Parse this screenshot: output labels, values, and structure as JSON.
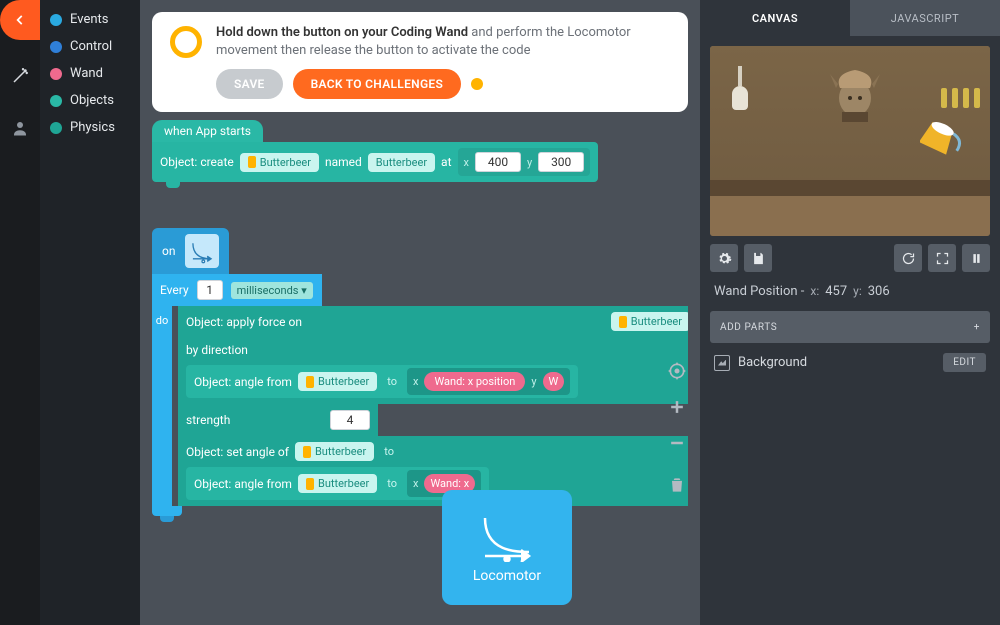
{
  "sidebar": {
    "items": [
      {
        "label": "Events",
        "color": "#2aa9e0"
      },
      {
        "label": "Control",
        "color": "#2f7fd8"
      },
      {
        "label": "Wand",
        "color": "#ef6a8e"
      },
      {
        "label": "Objects",
        "color": "#2ab8a6"
      },
      {
        "label": "Physics",
        "color": "#1fa595"
      }
    ]
  },
  "banner": {
    "bold": "Hold down the button on your Coding Wand",
    "rest": " and perform the Locomotor movement then release the button to activate the code",
    "save": "SAVE",
    "back": "BACK TO CHALLENGES"
  },
  "blocks": {
    "hat": "when App starts",
    "obj_create": "Object: create",
    "butterbeer": "Butterbeer",
    "named": "named",
    "at": "at",
    "x": "x",
    "y": "y",
    "xv": "400",
    "yv": "300",
    "on": "on",
    "every": "Every",
    "every_n": "1",
    "ms": "milliseconds",
    "do": "do",
    "apply": "Object: apply force on",
    "bydir": "by direction",
    "angle_from": "Object: angle from",
    "to": "to",
    "wand_x": "Wand: x position",
    "wand_cut": "W",
    "strength": "strength",
    "strength_v": "4",
    "set_angle": "Object: set angle of",
    "wand_x2": "Wand: x"
  },
  "locomotor": {
    "label": "Locomotor"
  },
  "right": {
    "tabs": {
      "canvas": "CANVAS",
      "js": "JAVASCRIPT"
    },
    "wand_label": "Wand Position -",
    "wand_x_lab": "x:",
    "wand_x": "457",
    "wand_y_lab": "y:",
    "wand_y": "306",
    "add_parts": "ADD PARTS",
    "background": "Background",
    "edit": "EDIT"
  }
}
